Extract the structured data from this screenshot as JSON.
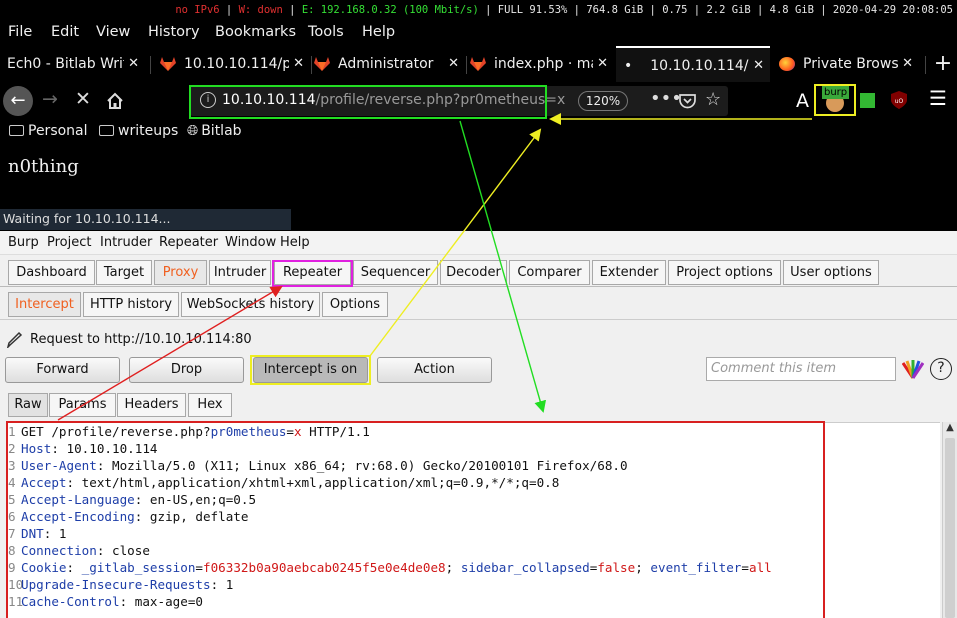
{
  "statusbar": {
    "ipv6": "no IPv6",
    "wifi": "W: down",
    "eth": "E: 192.168.0.32 (100 Mbit/s)",
    "battery": "FULL 91.53%",
    "disk": "764.8 GiB",
    "load": "0.75",
    "mem": "2.2 GiB | 4.8 GiB",
    "time": "2020-04-29 20:08:05"
  },
  "firefox": {
    "menu": [
      "File",
      "Edit",
      "View",
      "History",
      "Bookmarks",
      "Tools",
      "Help"
    ],
    "tabs": [
      {
        "label": "Ech0 - Bitlab Write"
      },
      {
        "label": "10.10.10.114/p"
      },
      {
        "label": "Administrator"
      },
      {
        "label": "index.php · ma"
      },
      {
        "label": "10.10.10.114/p"
      },
      {
        "label": "Private Browsi"
      }
    ],
    "new_tab": "+",
    "url_host": "10.10.10.114",
    "url_path": "/profile/reverse.php?pr0metheus=x",
    "zoom": "120%",
    "burp_label": "burp",
    "reader_label": "A",
    "bookmarks": [
      "Personal",
      "writeups",
      "Bitlab"
    ],
    "page_text": "n0thing",
    "loading": "Waiting for 10.10.10.114..."
  },
  "burp": {
    "menu": [
      "Burp",
      "Project",
      "Intruder",
      "Repeater",
      "Window",
      "Help"
    ],
    "tabs": [
      "Dashboard",
      "Target",
      "Proxy",
      "Intruder",
      "Repeater",
      "Sequencer",
      "Decoder",
      "Comparer",
      "Extender",
      "Project options",
      "User options"
    ],
    "subtabs": [
      "Intercept",
      "HTTP history",
      "WebSockets history",
      "Options"
    ],
    "request_label": "Request to http://10.10.10.114:80",
    "buttons": {
      "forward": "Forward",
      "drop": "Drop",
      "intercept": "Intercept is on",
      "action": "Action"
    },
    "comment_placeholder": "Comment this item",
    "help": "?",
    "request_tabs": [
      "Raw",
      "Params",
      "Headers",
      "Hex"
    ],
    "request_lines": {
      "l1": {
        "method": "GET ",
        "path": "/profile/reverse.php?",
        "param": "pr0metheus",
        "eq": "=",
        "value": "x",
        "proto": " HTTP/1.1"
      },
      "l2": {
        "name": "Host",
        "value": ": 10.10.10.114"
      },
      "l3": {
        "name": "User-Agent",
        "value": ": Mozilla/5.0 (X11; Linux x86_64; rv:68.0) Gecko/20100101 Firefox/68.0"
      },
      "l4": {
        "name": "Accept",
        "value": ": text/html,application/xhtml+xml,application/xml;q=0.9,*/*;q=0.8"
      },
      "l5": {
        "name": "Accept-Language",
        "value": ": en-US,en;q=0.5"
      },
      "l6": {
        "name": "Accept-Encoding",
        "value": ": gzip, deflate"
      },
      "l7": {
        "name": "DNT",
        "value": ": 1"
      },
      "l8": {
        "name": "Connection",
        "value": ": close"
      },
      "l9": {
        "name": "Cookie",
        "sep": ": ",
        "c1n": "_gitlab_session",
        "c1v": "f06332b0a90aebcab0245f5e0e4de0e8",
        "s1": "; ",
        "c2n": "sidebar_collapsed",
        "c2v": "false",
        "s2": "; ",
        "c3n": "event_filter",
        "c3v": "all",
        "eq": "="
      },
      "l10": {
        "name": "Upgrade-Insecure-Requests",
        "value": ": 1"
      },
      "l11": {
        "name": "Cache-Control",
        "value": ": max-age=0"
      }
    },
    "line_numbers": [
      "1",
      "2",
      "3",
      "4",
      "5",
      "6",
      "7",
      "8",
      "9",
      "10",
      "11"
    ]
  },
  "colors": {
    "highlight_green": "#22dd22",
    "highlight_yellow": "#eeee22",
    "highlight_red": "#d82020",
    "highlight_magenta": "#e020e0",
    "burp_accent": "#f06020"
  }
}
